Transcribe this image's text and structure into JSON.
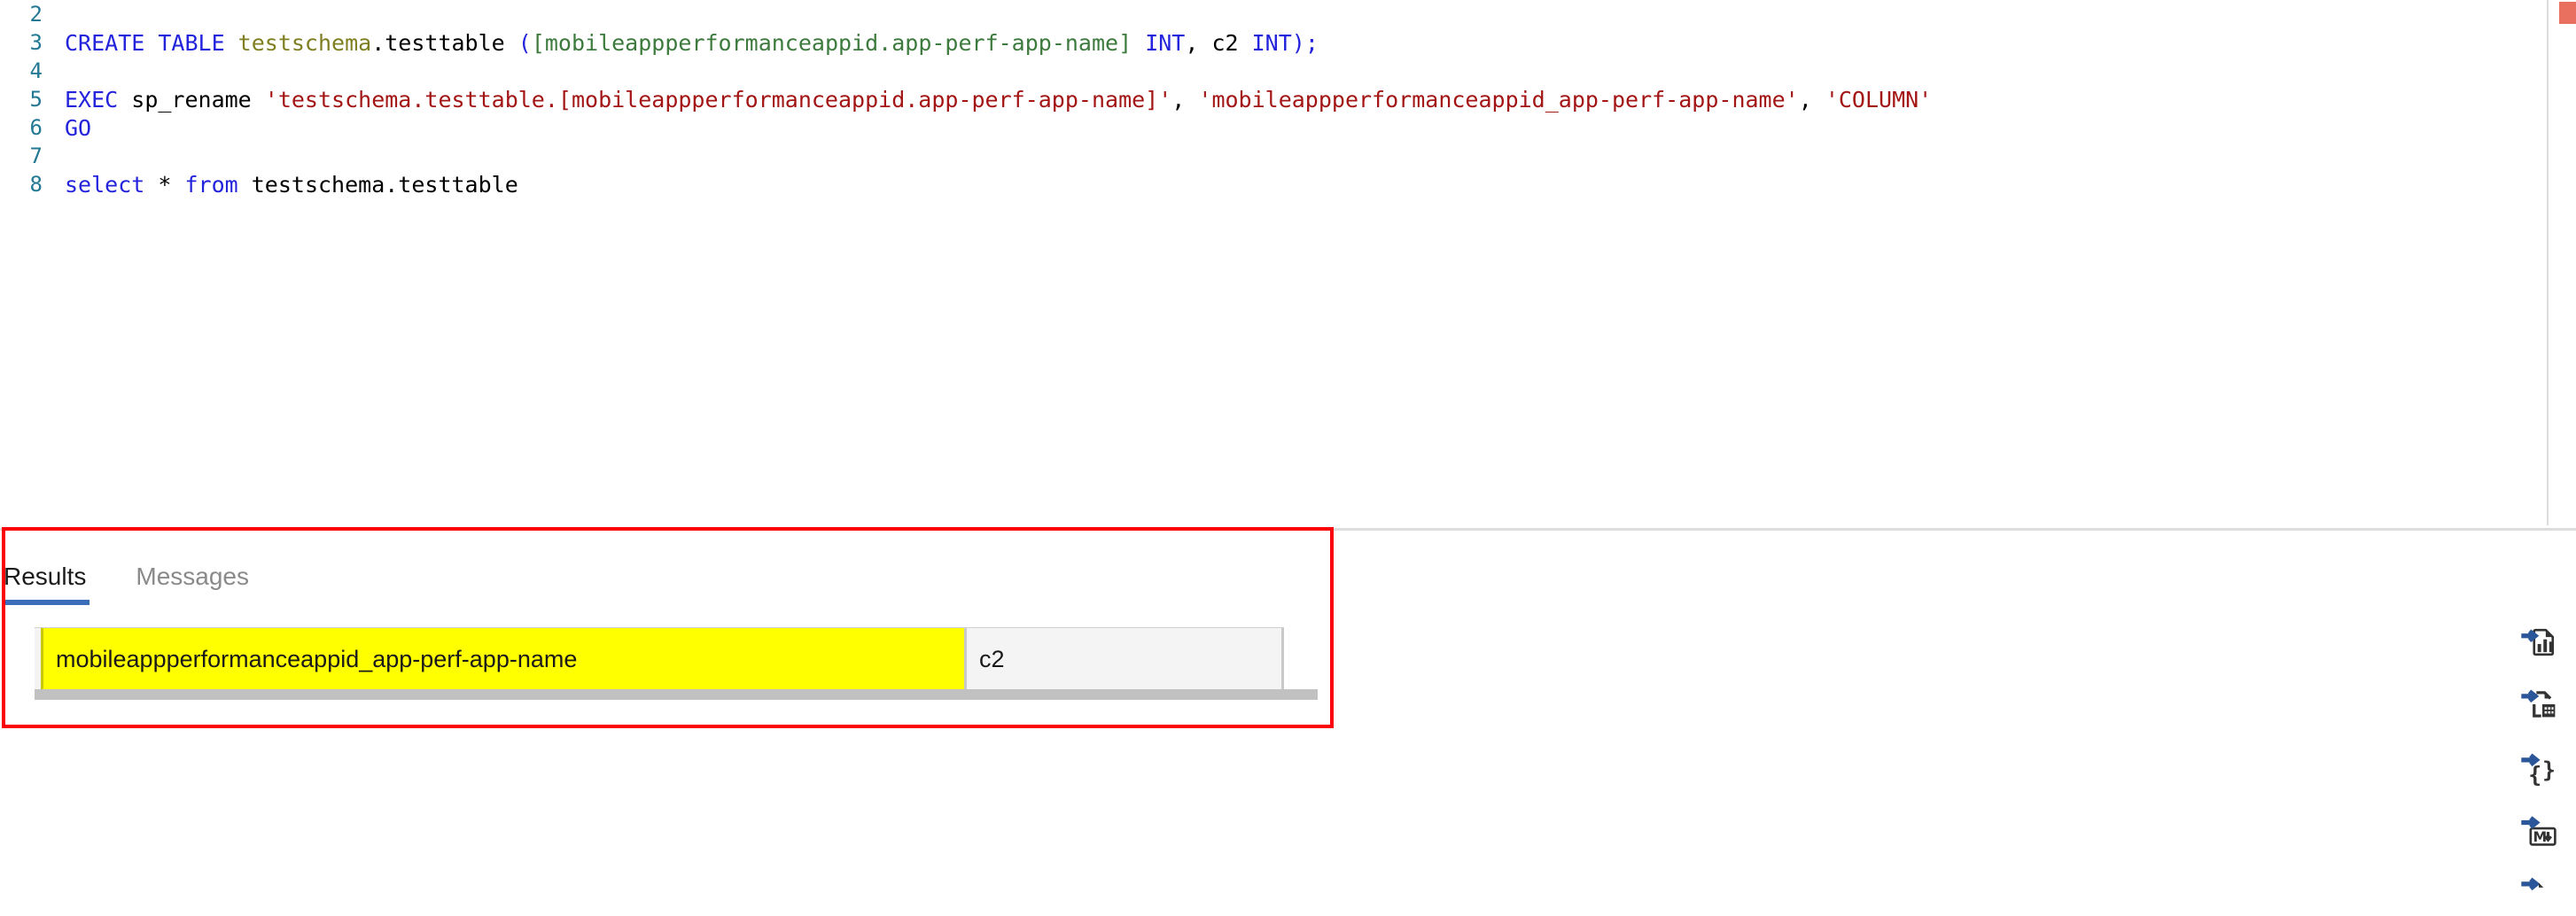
{
  "editor": {
    "language": "sql",
    "lines": [
      {
        "number": "2",
        "tokens": [
          {
            "t": "",
            "c": "plain"
          }
        ]
      },
      {
        "number": "3",
        "tokens": [
          {
            "t": "CREATE TABLE ",
            "c": "kw"
          },
          {
            "t": "testschema",
            "c": "ident"
          },
          {
            "t": ".",
            "c": "punc"
          },
          {
            "t": "testtable ",
            "c": "plain"
          },
          {
            "t": "(",
            "c": "kw"
          },
          {
            "t": "[mobileappperformanceappid.app-perf-app-name]",
            "c": "brk"
          },
          {
            "t": " ",
            "c": "plain"
          },
          {
            "t": "INT",
            "c": "kw"
          },
          {
            "t": ", c2 ",
            "c": "punc"
          },
          {
            "t": "INT)",
            "c": "kw"
          },
          {
            "t": ";",
            "c": "kw"
          }
        ]
      },
      {
        "number": "4",
        "tokens": [
          {
            "t": "",
            "c": "plain"
          }
        ]
      },
      {
        "number": "5",
        "tokens": [
          {
            "t": "EXEC ",
            "c": "kw"
          },
          {
            "t": "sp_rename ",
            "c": "plain"
          },
          {
            "t": "'testschema.testtable.[mobileappperformanceappid.app-perf-app-name]'",
            "c": "str"
          },
          {
            "t": ", ",
            "c": "punc"
          },
          {
            "t": "'mobileappperformanceappid_app-perf-app-name'",
            "c": "str"
          },
          {
            "t": ", ",
            "c": "punc"
          },
          {
            "t": "'COLUMN'",
            "c": "str"
          }
        ]
      },
      {
        "number": "6",
        "tokens": [
          {
            "t": "GO",
            "c": "kw"
          }
        ]
      },
      {
        "number": "7",
        "tokens": [
          {
            "t": "",
            "c": "plain"
          }
        ]
      },
      {
        "number": "8",
        "tokens": [
          {
            "t": "select ",
            "c": "kw"
          },
          {
            "t": "* ",
            "c": "punc"
          },
          {
            "t": "from ",
            "c": "kw"
          },
          {
            "t": "testschema.testtable",
            "c": "plain"
          }
        ]
      }
    ],
    "overview_ruler": {
      "error_marker_color": "#e9705f"
    }
  },
  "results": {
    "tabs": [
      {
        "label": "Results",
        "active": true
      },
      {
        "label": "Messages",
        "active": false
      }
    ],
    "active_tab_underline_color": "#3a6ebb",
    "grid": {
      "columns": [
        {
          "label": "mobileappperformanceappid_app-perf-app-name",
          "highlight": true,
          "highlight_color": "#ffff00"
        },
        {
          "label": "c2",
          "highlight": false
        }
      ],
      "rows": []
    }
  },
  "annotation": {
    "box_color": "#fb0007"
  },
  "action_bar": {
    "buttons": [
      {
        "name": "chart-viewer-icon",
        "title": "Chart"
      },
      {
        "name": "save-as-excel-icon",
        "title": "Save as Excel"
      },
      {
        "name": "save-as-json-icon",
        "title": "Save as JSON"
      },
      {
        "name": "save-as-markdown-icon",
        "title": "Save as Markdown"
      },
      {
        "name": "save-as-csv-icon",
        "title": "Save as CSV"
      }
    ]
  }
}
